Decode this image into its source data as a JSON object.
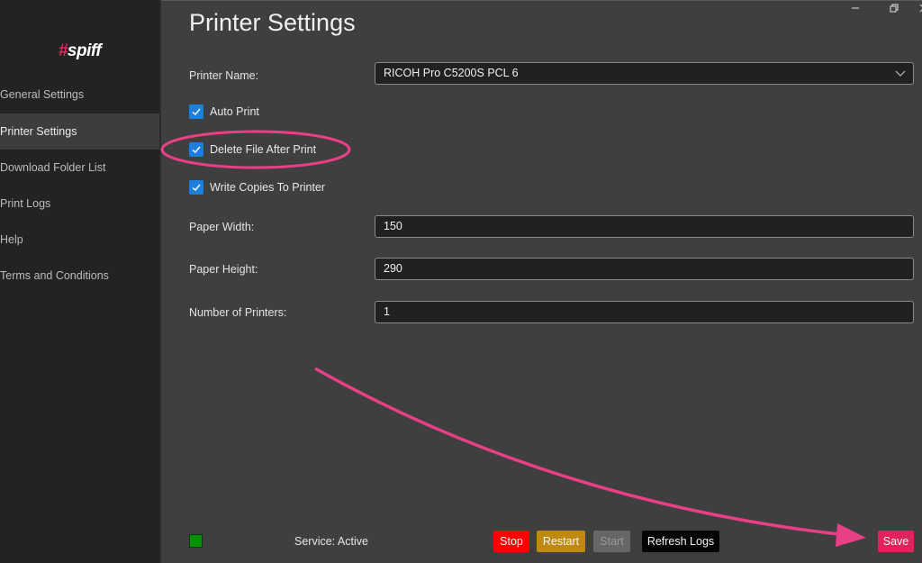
{
  "app": {
    "logo_hash": "#",
    "logo_text": "spiff"
  },
  "window_controls": {
    "minimize_glyph": "—",
    "restore_glyph": "❐",
    "close_glyph": "✕"
  },
  "sidebar": {
    "items": [
      {
        "label": "General Settings",
        "active": false
      },
      {
        "label": "Printer Settings",
        "active": true
      },
      {
        "label": "Download Folder List",
        "active": false
      },
      {
        "label": "Print Logs",
        "active": false
      },
      {
        "label": "Help",
        "active": false
      },
      {
        "label": "Terms and Conditions",
        "active": false
      }
    ]
  },
  "main": {
    "title": "Printer Settings",
    "printer_name": {
      "label": "Printer Name:",
      "value": "RICOH Pro C5200S PCL 6"
    },
    "checkboxes": [
      {
        "label": "Auto Print",
        "checked": true
      },
      {
        "label": "Delete File After Print",
        "checked": true,
        "highlighted": true
      },
      {
        "label": "Write Copies To Printer",
        "checked": true
      }
    ],
    "paper_width": {
      "label": "Paper Width:",
      "value": "150"
    },
    "paper_height": {
      "label": "Paper Height:",
      "value": "290"
    },
    "number_of_printers": {
      "label": "Number of Printers:",
      "value": "1"
    }
  },
  "footer": {
    "service_status": "Service: Active",
    "status_color": "#079107",
    "buttons": {
      "stop": "Stop",
      "restart": "Restart",
      "start": "Start",
      "refresh_logs": "Refresh Logs",
      "save": "Save"
    }
  },
  "annotation": {
    "color": "#e83f86",
    "type": "arrow pointing to Save, ellipse around Delete File After Print"
  }
}
